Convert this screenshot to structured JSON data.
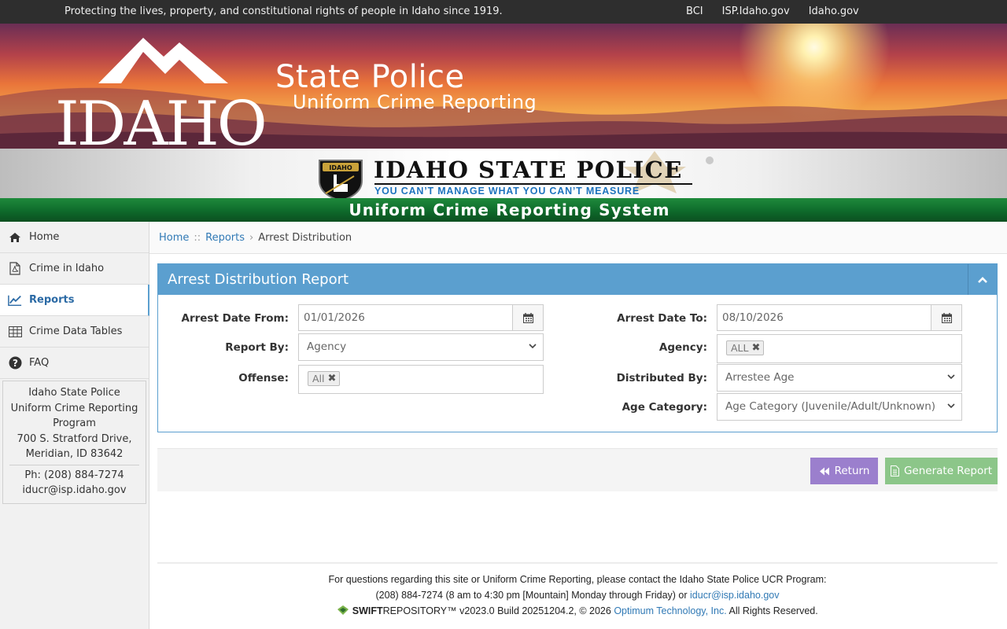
{
  "topbar": {
    "motto": "Protecting the lives, property, and constitutional rights of people in Idaho since 1919.",
    "links": [
      "BCI",
      "ISP.Idaho.gov",
      "Idaho.gov"
    ]
  },
  "banner": {
    "logo_text": "IDAHO",
    "title": "State Police",
    "subtitle": "Uniform Crime Reporting"
  },
  "isp_band": {
    "badge_text": "IDAHO",
    "name": "IDAHO STATE POLICE",
    "tagline": "YOU CAN’T MANAGE WHAT YOU CAN’T MEASURE"
  },
  "system_title": "Uniform Crime Reporting System",
  "sidebar": {
    "items": [
      {
        "label": "Home",
        "icon": "home-icon",
        "active": false
      },
      {
        "label": "Crime in Idaho",
        "icon": "pdf-icon",
        "active": false
      },
      {
        "label": "Reports",
        "icon": "line-chart-icon",
        "active": true
      },
      {
        "label": "Crime Data Tables",
        "icon": "table-icon",
        "active": false
      },
      {
        "label": "FAQ",
        "icon": "question-icon",
        "active": false
      }
    ],
    "contact": {
      "org_line1": "Idaho State Police",
      "org_line2": "Uniform Crime Reporting",
      "org_line3": "Program",
      "address1": "700 S. Stratford Drive,",
      "address2": "Meridian, ID 83642",
      "phone": "Ph: (208) 884-7274",
      "email": "iducr@isp.idaho.gov"
    }
  },
  "breadcrumb": {
    "home": "Home",
    "sep1": "::",
    "reports": "Reports",
    "sep2": "›",
    "current": "Arrest Distribution"
  },
  "panel": {
    "title": "Arrest Distribution Report",
    "fields": {
      "date_from": {
        "label": "Arrest Date From:",
        "value": "01/01/2026"
      },
      "date_to": {
        "label": "Arrest Date To:",
        "value": "08/10/2026"
      },
      "report_by": {
        "label": "Report By:",
        "value": "Agency"
      },
      "agency": {
        "label": "Agency:",
        "tag": "ALL"
      },
      "offense": {
        "label": "Offense:",
        "tag": "All"
      },
      "distributed_by": {
        "label": "Distributed By:",
        "value": "Arrestee Age"
      },
      "age_category": {
        "label": "Age Category:",
        "value": "Age Category (Juvenile/Adult/Unknown)"
      }
    }
  },
  "actions": {
    "return_label": "Return",
    "generate_label": "Generate Report"
  },
  "footer": {
    "line1": "For questions regarding this site or Uniform Crime Reporting, please contact the Idaho State Police UCR Program:",
    "line2_text": "(208) 884-7274 (8 am to 4:30 pm [Mountain] Monday through Friday) or",
    "line2_email": "iducr@isp.idaho.gov",
    "swift": "SWIFT",
    "repository": "REPOSITORY™",
    "version": "v2023.0 Build 20251204.2, © 2026",
    "company": "Optimum Technology, Inc.",
    "rights": "All Rights Reserved."
  },
  "colors": {
    "panel_blue": "#5b9fcf",
    "return_purple": "#9b7fcd",
    "generate_green": "#8cc689",
    "link_blue": "#3079b5",
    "system_green": "#0e6a2b"
  }
}
